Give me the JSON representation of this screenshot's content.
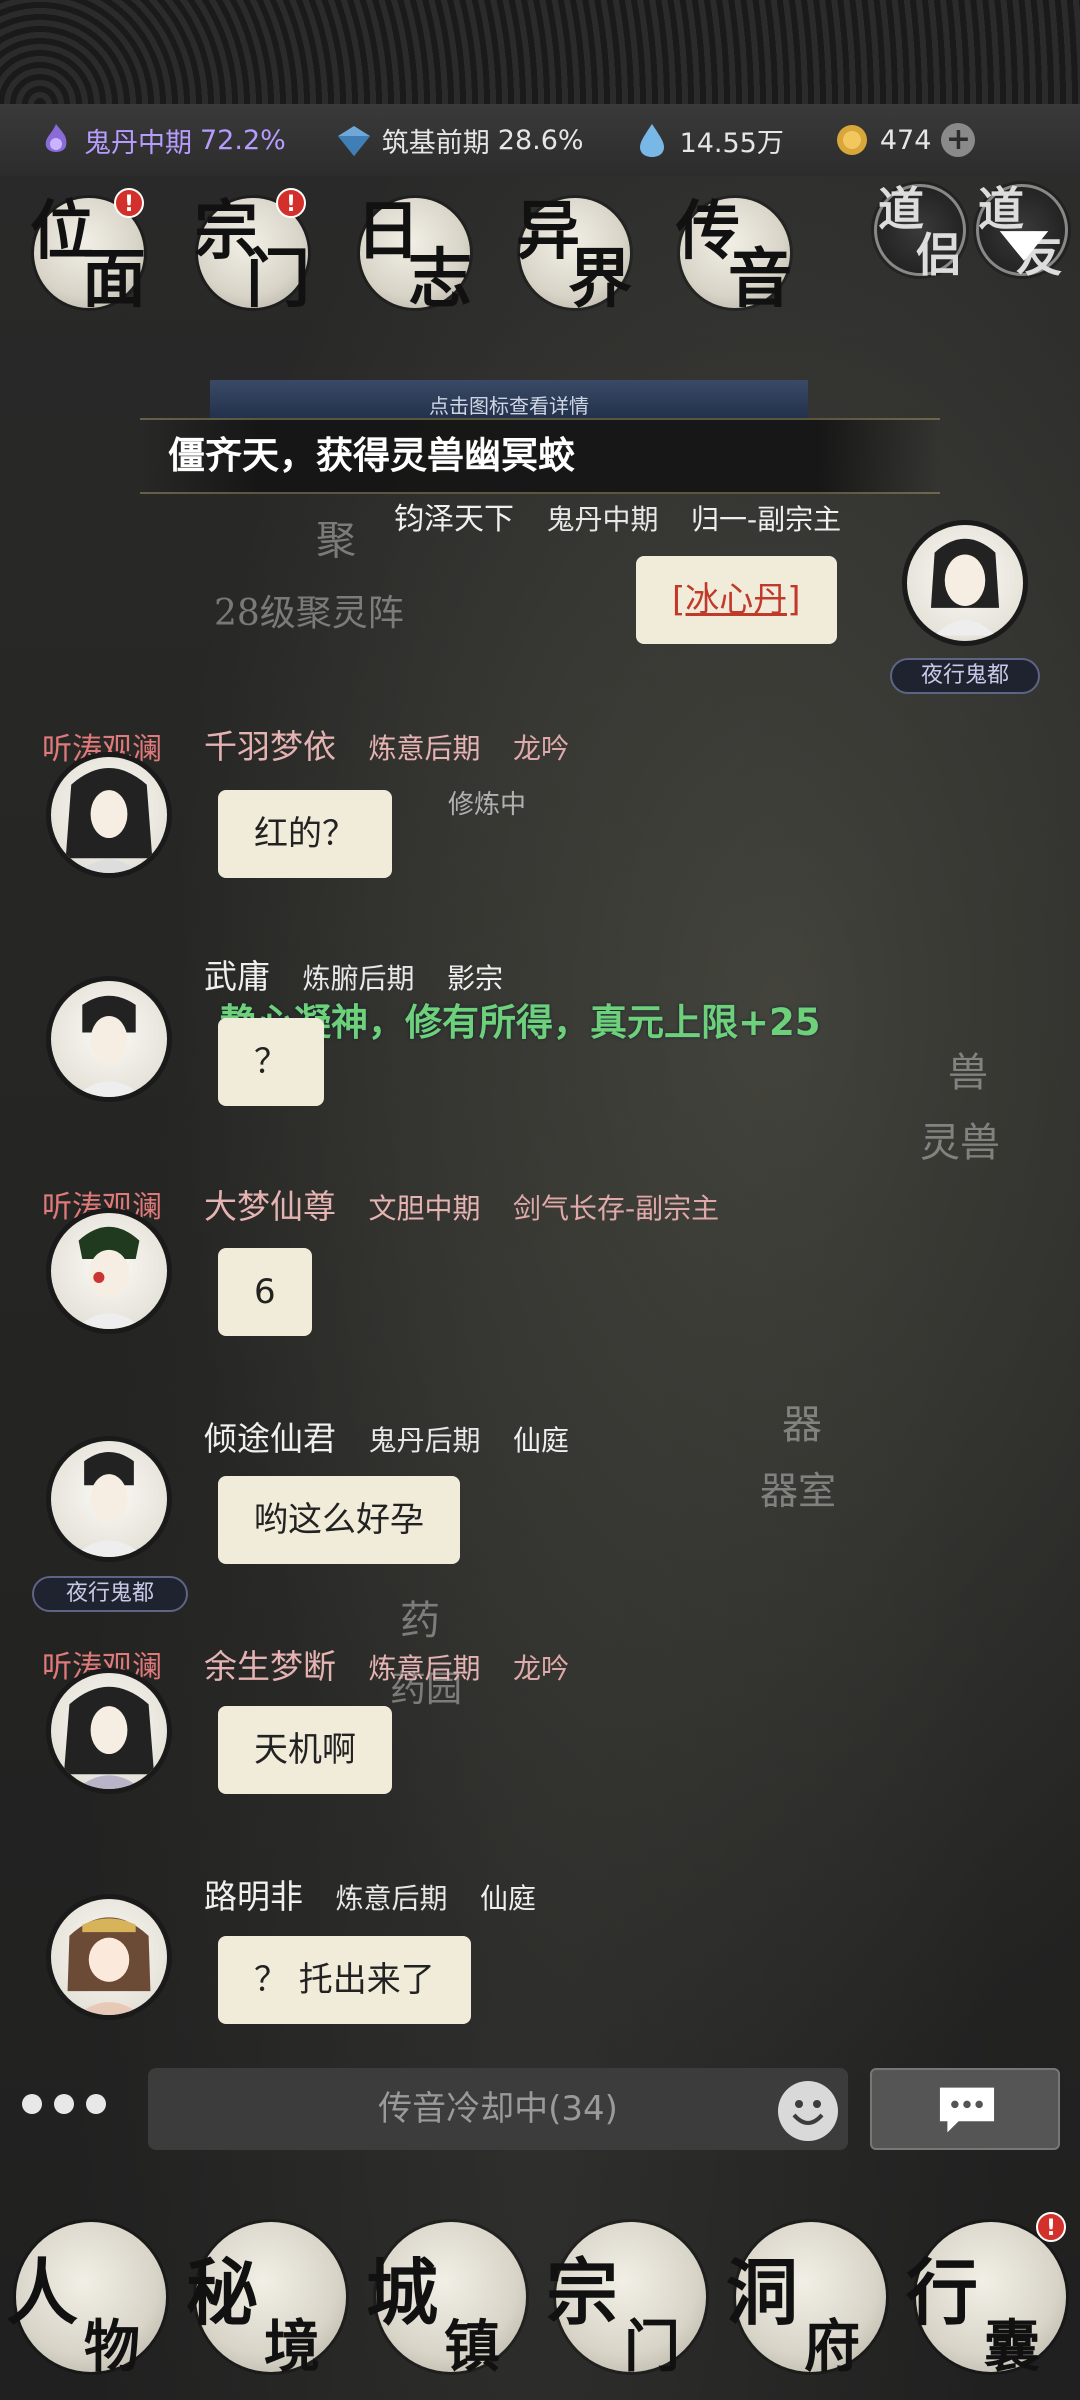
{
  "status_bar": {
    "realm_label": "鬼丹中期",
    "realm_pct": "72.2%",
    "foundation_label": "筑基前期",
    "foundation_pct": "28.6%",
    "spirit_value": "14.55万",
    "coin_value": "474"
  },
  "top_menu": [
    {
      "c1": "位",
      "c2": "面",
      "badge": "!"
    },
    {
      "c1": "宗",
      "c2": "门",
      "badge": "!"
    },
    {
      "c1": "日",
      "c2": "志",
      "badge": ""
    },
    {
      "c1": "异",
      "c2": "界",
      "badge": ""
    },
    {
      "c1": "传",
      "c2": "音",
      "badge": ""
    }
  ],
  "daolv": {
    "c1": "道",
    "c2": "侣"
  },
  "daoyou": {
    "c1": "道",
    "c2": "友"
  },
  "banner_hint": "点击图标查看详情",
  "announcement": "僵齐天，获得灵兽幽冥蛟",
  "floating_buff": "静心凝神，修有所得，真元上限+25",
  "scene_labels": {
    "cultivating": "修炼中",
    "array": "28级聚灵阵",
    "ju": "聚",
    "beast": "兽",
    "beast2": "灵兽",
    "weapon": "器",
    "weapon2": "器室",
    "herb": "药",
    "herb2": "药园"
  },
  "messages": [
    {
      "name": "钧泽天下",
      "rank": "鬼丹中期",
      "sect": "归一-副宗主",
      "text": "[冰心丹]",
      "title": "夜行鬼都",
      "tag": ""
    },
    {
      "name": "千羽梦依",
      "rank": "炼意后期",
      "sect": "龙吟",
      "text": "红的？",
      "title": "",
      "tag": "听涛观澜"
    },
    {
      "name": "武庸",
      "rank": "炼腑后期",
      "sect": "影宗",
      "text": "？",
      "title": "",
      "tag": ""
    },
    {
      "name": "大梦仙尊",
      "rank": "文胆中期",
      "sect": "剑气长存-副宗主",
      "text": "6",
      "title": "",
      "tag": "听涛观澜"
    },
    {
      "name": "倾途仙君",
      "rank": "鬼丹后期",
      "sect": "仙庭",
      "text": "哟这么好孕",
      "title": "夜行鬼都",
      "tag": ""
    },
    {
      "name": "余生梦断",
      "rank": "炼意后期",
      "sect": "龙吟",
      "text": "天机啊",
      "title": "",
      "tag": "听涛观澜"
    },
    {
      "name": "路明非",
      "rank": "炼意后期",
      "sect": "仙庭",
      "text": "？ 托出来了",
      "title": "",
      "tag": ""
    }
  ],
  "input": {
    "placeholder": "传音冷却中(34)"
  },
  "bottom_nav": [
    {
      "c1": "人",
      "c2": "物",
      "badge": ""
    },
    {
      "c1": "秘",
      "c2": "境",
      "badge": ""
    },
    {
      "c1": "城",
      "c2": "镇",
      "badge": ""
    },
    {
      "c1": "宗",
      "c2": "门",
      "badge": ""
    },
    {
      "c1": "洞",
      "c2": "府",
      "badge": ""
    },
    {
      "c1": "行",
      "c2": "囊",
      "badge": "!"
    }
  ]
}
